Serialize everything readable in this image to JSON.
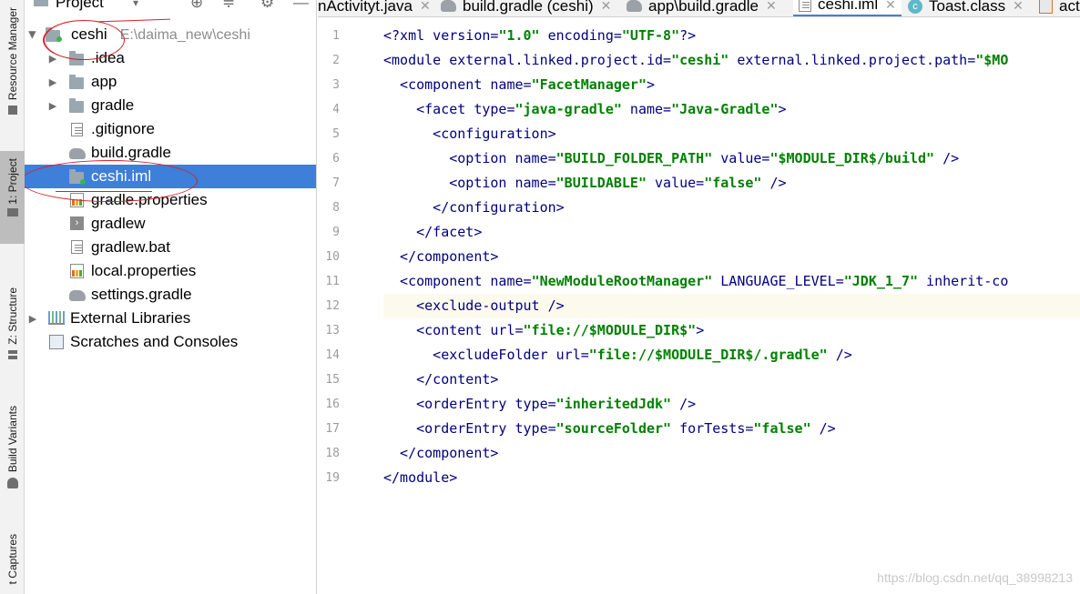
{
  "tool_stripe": {
    "items": [
      {
        "label": "Resource Manager",
        "icon": "resource-manager-icon"
      },
      {
        "label": "1: Project",
        "icon": "folder-icon"
      },
      {
        "label": "Z: Structure",
        "icon": "structure-icon"
      },
      {
        "label": "Build Variants",
        "icon": "android-icon"
      },
      {
        "label": "t Captures",
        "icon": "captures-icon"
      }
    ]
  },
  "project_panel": {
    "title": "Project",
    "root": {
      "name": "ceshi",
      "path": "E:\\daima_new\\ceshi"
    },
    "items": [
      {
        "label": ".idea",
        "type": "folder",
        "expandable": true
      },
      {
        "label": "app",
        "type": "folder",
        "expandable": true
      },
      {
        "label": "gradle",
        "type": "folder",
        "expandable": true
      },
      {
        "label": ".gitignore",
        "type": "file"
      },
      {
        "label": "build.gradle",
        "type": "gradle"
      },
      {
        "label": "ceshi.iml",
        "type": "module-file",
        "selected": true
      },
      {
        "label": "gradle.properties",
        "type": "properties"
      },
      {
        "label": "gradlew",
        "type": "terminal-file"
      },
      {
        "label": "gradlew.bat",
        "type": "file"
      },
      {
        "label": "local.properties",
        "type": "properties"
      },
      {
        "label": "settings.gradle",
        "type": "gradle"
      }
    ],
    "external_libraries": "External Libraries",
    "scratches": "Scratches and Consoles"
  },
  "editor": {
    "tabs": [
      {
        "label": "nActivityt.java",
        "icon": "java-file-icon",
        "active": false
      },
      {
        "label": "build.gradle (ceshi)",
        "icon": "gradle-icon",
        "active": false
      },
      {
        "label": "app\\build.gradle",
        "icon": "gradle-icon",
        "active": false
      },
      {
        "label": "ceshi.iml",
        "icon": "module-file-icon",
        "active": true
      },
      {
        "label": "Toast.class",
        "icon": "class-icon",
        "active": false
      },
      {
        "label": "act",
        "icon": "xml-file-icon",
        "active": false
      }
    ],
    "lines": [
      "<?xml version=\"1.0\" encoding=\"UTF-8\"?>",
      "<module external.linked.project.id=\"ceshi\" external.linked.project.path=\"$MO",
      "  <component name=\"FacetManager\">",
      "    <facet type=\"java-gradle\" name=\"Java-Gradle\">",
      "      <configuration>",
      "        <option name=\"BUILD_FOLDER_PATH\" value=\"$MODULE_DIR$/build\" />",
      "        <option name=\"BUILDABLE\" value=\"false\" />",
      "      </configuration>",
      "    </facet>",
      "  </component>",
      "  <component name=\"NewModuleRootManager\" LANGUAGE_LEVEL=\"JDK_1_7\" inherit-co",
      "    <exclude-output />",
      "    <content url=\"file://$MODULE_DIR$\">",
      "      <excludeFolder url=\"file://$MODULE_DIR$/.gradle\" />",
      "    </content>",
      "    <orderEntry type=\"inheritedJdk\" />",
      "    <orderEntry type=\"sourceFolder\" forTests=\"false\" />",
      "  </component>",
      "</module>"
    ],
    "caret_line": 12,
    "colors": {
      "tag": "#000080",
      "attr_value": "#008000",
      "line_number": "#9c9c9c",
      "selection": "#3d7fd9",
      "caret_row": "#fcfaed"
    }
  },
  "watermark": "https://blog.csdn.net/qq_38998213"
}
